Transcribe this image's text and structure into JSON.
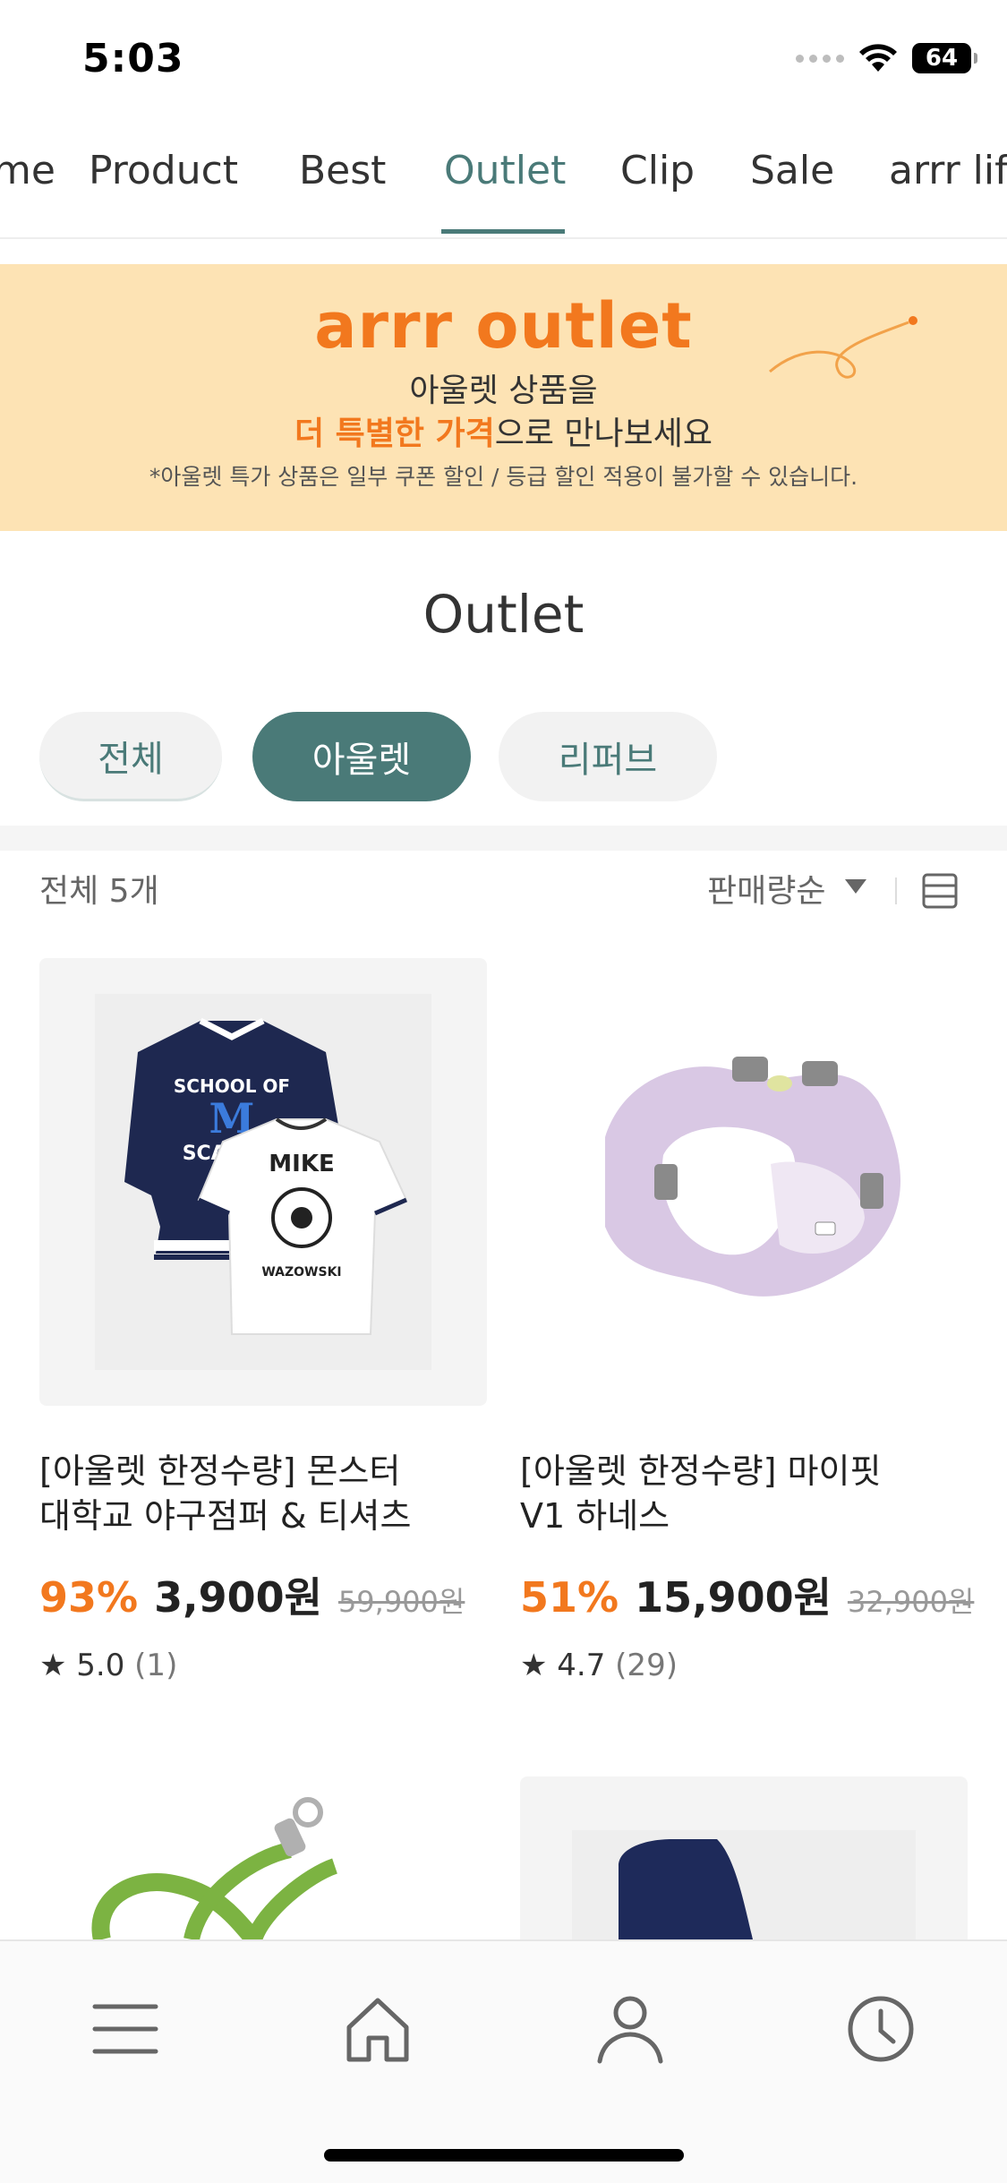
{
  "status_bar": {
    "time": "5:03",
    "battery": "64"
  },
  "tabs": [
    {
      "label": "me",
      "active": false
    },
    {
      "label": "Product",
      "active": false
    },
    {
      "label": "Best",
      "active": false
    },
    {
      "label": "Outlet",
      "active": true
    },
    {
      "label": "Clip",
      "active": false
    },
    {
      "label": "Sale",
      "active": false
    },
    {
      "label": "arrr lif",
      "active": false
    }
  ],
  "banner": {
    "title": "arrr outlet",
    "line1": "아울렛 상품을",
    "line2_highlight": "더 특별한 가격",
    "line2_rest": "으로 만나보세요",
    "note": "*아울렛 특가 상품은 일부 쿠폰 할인 / 등급 할인 적용이 불가할 수 있습니다."
  },
  "section_title": "Outlet",
  "filters": [
    {
      "label": "전체",
      "selected": false
    },
    {
      "label": "아울렛",
      "selected": true
    },
    {
      "label": "리퍼브",
      "selected": false
    }
  ],
  "list_header": {
    "count": "전체 5개",
    "sort": "판매량순"
  },
  "products": [
    {
      "title_line1": "[아울렛 한정수량] 몬스터",
      "title_line2": "대학교 야구점퍼 & 티셔츠",
      "discount": "93%",
      "price": "3,900원",
      "original_price": "59,900원",
      "rating": "★ 5.0",
      "review_count": "(1)",
      "jacket_text1": "SCHOOL OF",
      "jacket_text2": "M",
      "jacket_text3": "SCARING",
      "shirt_text1": "MIKE",
      "shirt_text2": "WAZOWSKI"
    },
    {
      "title_line1": "[아울렛 한정수량] 마이핏",
      "title_line2": "V1 하네스",
      "discount": "51%",
      "price": "15,900원",
      "original_price": "32,900원",
      "rating": "★ 4.7",
      "review_count": "(29)"
    }
  ],
  "colors": {
    "accent": "#4a7a78",
    "orange": "#f2781e",
    "banner_bg": "#fde3b4"
  }
}
